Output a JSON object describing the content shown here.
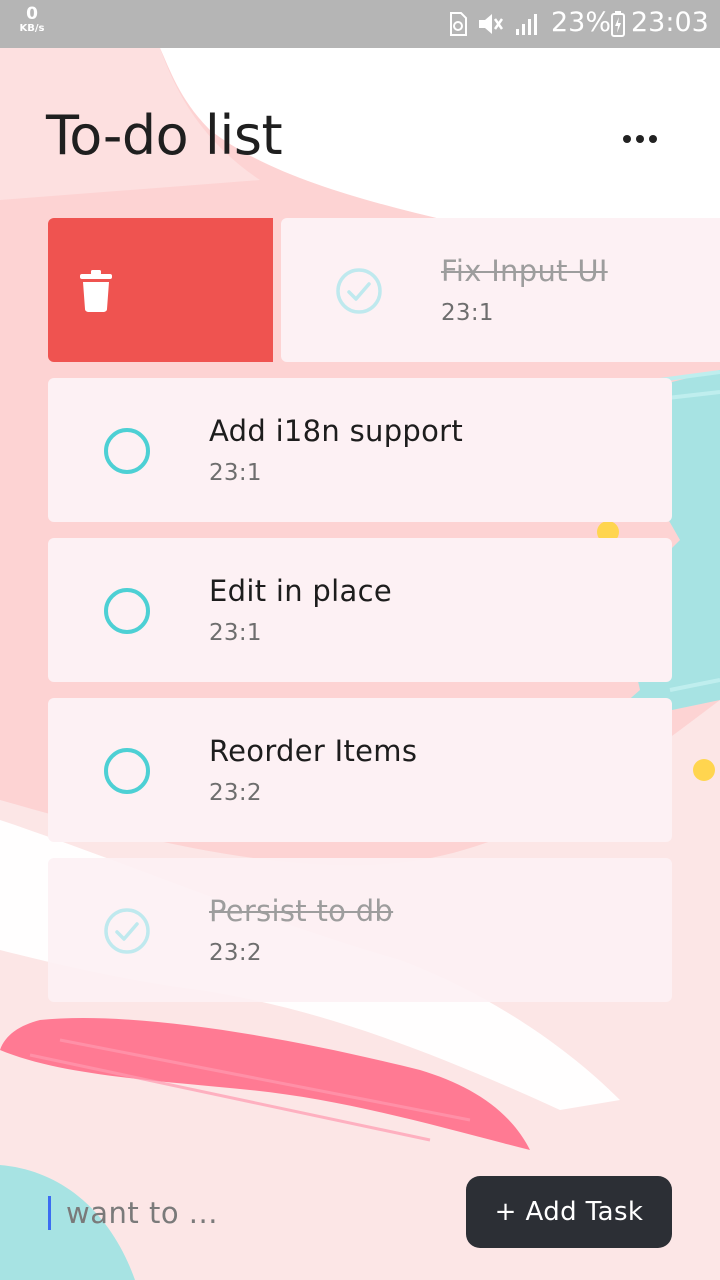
{
  "status_bar": {
    "speed_value": "0",
    "speed_unit": "KB/s",
    "battery_percent": "23%",
    "time": "23:03"
  },
  "header": {
    "title": "To-do list",
    "menu_icon": "more-horizontal-icon"
  },
  "swipe_action": {
    "icon": "trash-icon",
    "color": "#ef5350"
  },
  "tasks": [
    {
      "title": "Fix Input UI",
      "time": "23:1",
      "done": true
    },
    {
      "title": "Add i18n support",
      "time": "23:1",
      "done": false
    },
    {
      "title": "Edit in place",
      "time": "23:1",
      "done": false
    },
    {
      "title": "Reorder Items",
      "time": "23:2",
      "done": false
    },
    {
      "title": "Persist to db",
      "time": "23:2",
      "done": true
    }
  ],
  "input": {
    "placeholder": "want to ...",
    "value": ""
  },
  "add_button": {
    "label": "+ Add Task"
  },
  "colors": {
    "accent": "#4dd0d4",
    "card_bg": "#fdf1f4",
    "page_bg": "#fce6e6",
    "delete": "#ef5350",
    "button_bg": "#2c2f35"
  }
}
